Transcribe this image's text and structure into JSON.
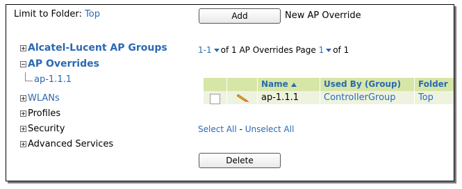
{
  "folder_filter": {
    "label": "Limit to Folder:",
    "value": "Top"
  },
  "tree": {
    "groups": "Alcatel-Lucent AP Groups",
    "ap_overrides": "AP Overrides",
    "ap_child": "ap-1.1.1",
    "wlans": "WLANs",
    "profiles": "Profiles",
    "security": "Security",
    "advanced": "Advanced Services"
  },
  "toolbar": {
    "add_label": "Add",
    "add_text": "New AP Override"
  },
  "pager": {
    "range": "1-1",
    "of_text": "of 1 AP Overrides  Page",
    "page": "1",
    "page_of": "of 1"
  },
  "table": {
    "headers": {
      "name": "Name",
      "used_by": "Used By (Group)",
      "folder": "Folder"
    },
    "rows": [
      {
        "name": "ap-1.1.1",
        "used_by": "ControllerGroup",
        "folder": "Top"
      }
    ]
  },
  "selection": {
    "select_all": "Select All",
    "dash": " - ",
    "unselect_all": "Unselect All"
  },
  "actions": {
    "delete_label": "Delete"
  },
  "colors": {
    "link": "#2a69b3",
    "header_bg": "#d6e6a6",
    "row_bg": "#eef3df"
  },
  "icons": {
    "edit": "pencil-icon",
    "sort": "sort-ascending-icon",
    "dropdown": "dropdown-caret-icon"
  }
}
